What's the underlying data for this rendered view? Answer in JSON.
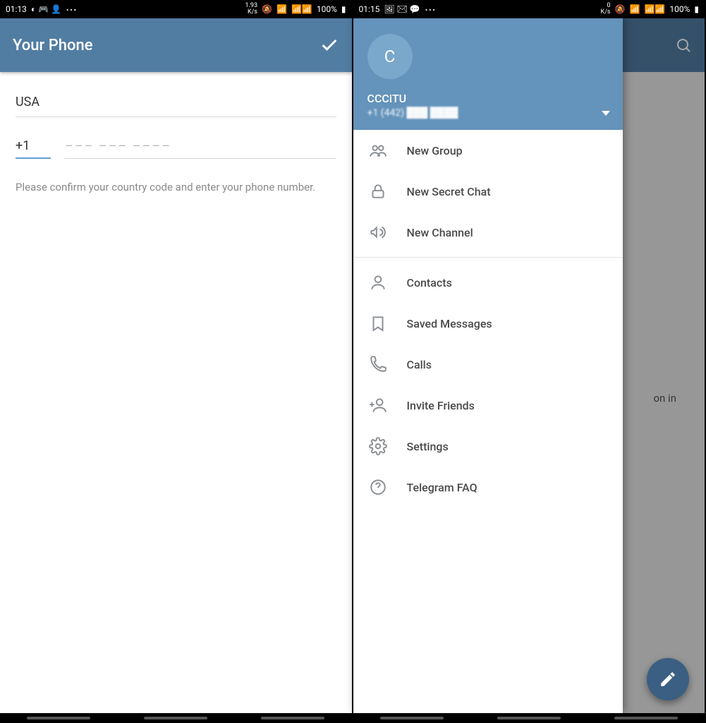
{
  "left": {
    "status": {
      "time": "01:13",
      "net": "1.93\nK/s",
      "battery": "100%"
    },
    "title": "Your Phone",
    "country": "USA",
    "code": "+1",
    "number_placeholder": "––– ––– ––––",
    "hint": "Please confirm your country code and enter your phone number."
  },
  "right": {
    "status": {
      "time": "01:15",
      "net": "0\nK/s",
      "battery": "100%"
    },
    "bg_text": "on in",
    "drawer": {
      "avatar_letter": "C",
      "name": "CCCiTU",
      "phone_prefix": "+1 (442)",
      "menu1": [
        {
          "icon": "group",
          "label": "New Group"
        },
        {
          "icon": "lock",
          "label": "New Secret Chat"
        },
        {
          "icon": "megaphone",
          "label": "New Channel"
        }
      ],
      "menu2": [
        {
          "icon": "person",
          "label": "Contacts"
        },
        {
          "icon": "bookmark",
          "label": "Saved Messages"
        },
        {
          "icon": "call",
          "label": "Calls"
        },
        {
          "icon": "invite",
          "label": "Invite Friends"
        },
        {
          "icon": "settings",
          "label": "Settings"
        },
        {
          "icon": "help",
          "label": "Telegram FAQ"
        }
      ]
    }
  }
}
